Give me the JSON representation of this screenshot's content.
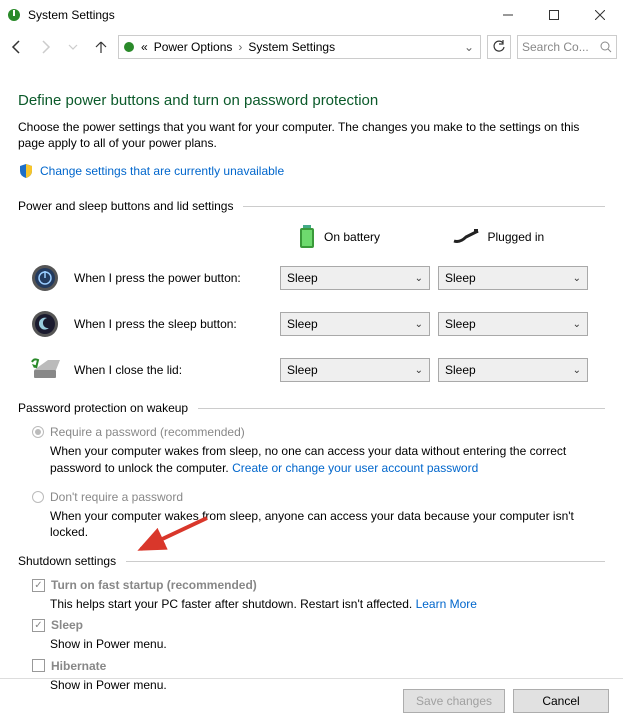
{
  "window": {
    "title": "System Settings"
  },
  "breadcrumb": {
    "seg1": "Power Options",
    "seg2": "System Settings"
  },
  "search": {
    "placeholder": "Search Co..."
  },
  "page": {
    "heading": "Define power buttons and turn on password protection",
    "description": "Choose the power settings that you want for your computer. The changes you make to the settings on this page apply to all of your power plans.",
    "change_link": "Change settings that are currently unavailable"
  },
  "section1": {
    "title": "Power and sleep buttons and lid settings",
    "col_battery": "On battery",
    "col_plugged": "Plugged in",
    "rows": [
      {
        "label": "When I press the power button:",
        "battery": "Sleep",
        "plugged": "Sleep"
      },
      {
        "label": "When I press the sleep button:",
        "battery": "Sleep",
        "plugged": "Sleep"
      },
      {
        "label": "When I close the lid:",
        "battery": "Sleep",
        "plugged": "Sleep"
      }
    ]
  },
  "section2": {
    "title": "Password protection on wakeup",
    "opt1": {
      "label": "Require a password (recommended)",
      "desc_a": "When your computer wakes from sleep, no one can access your data without entering the correct password to unlock the computer. ",
      "link": "Create or change your user account password"
    },
    "opt2": {
      "label": "Don't require a password",
      "desc": "When your computer wakes from sleep, anyone can access your data because your computer isn't locked."
    }
  },
  "section3": {
    "title": "Shutdown settings",
    "items": [
      {
        "label": "Turn on fast startup (recommended)",
        "desc": "This helps start your PC faster after shutdown. Restart isn't affected. ",
        "link": "Learn More",
        "checked": true
      },
      {
        "label": "Sleep",
        "desc": "Show in Power menu.",
        "checked": true
      },
      {
        "label": "Hibernate",
        "desc": "Show in Power menu.",
        "checked": false
      }
    ]
  },
  "footer": {
    "save": "Save changes",
    "cancel": "Cancel"
  }
}
